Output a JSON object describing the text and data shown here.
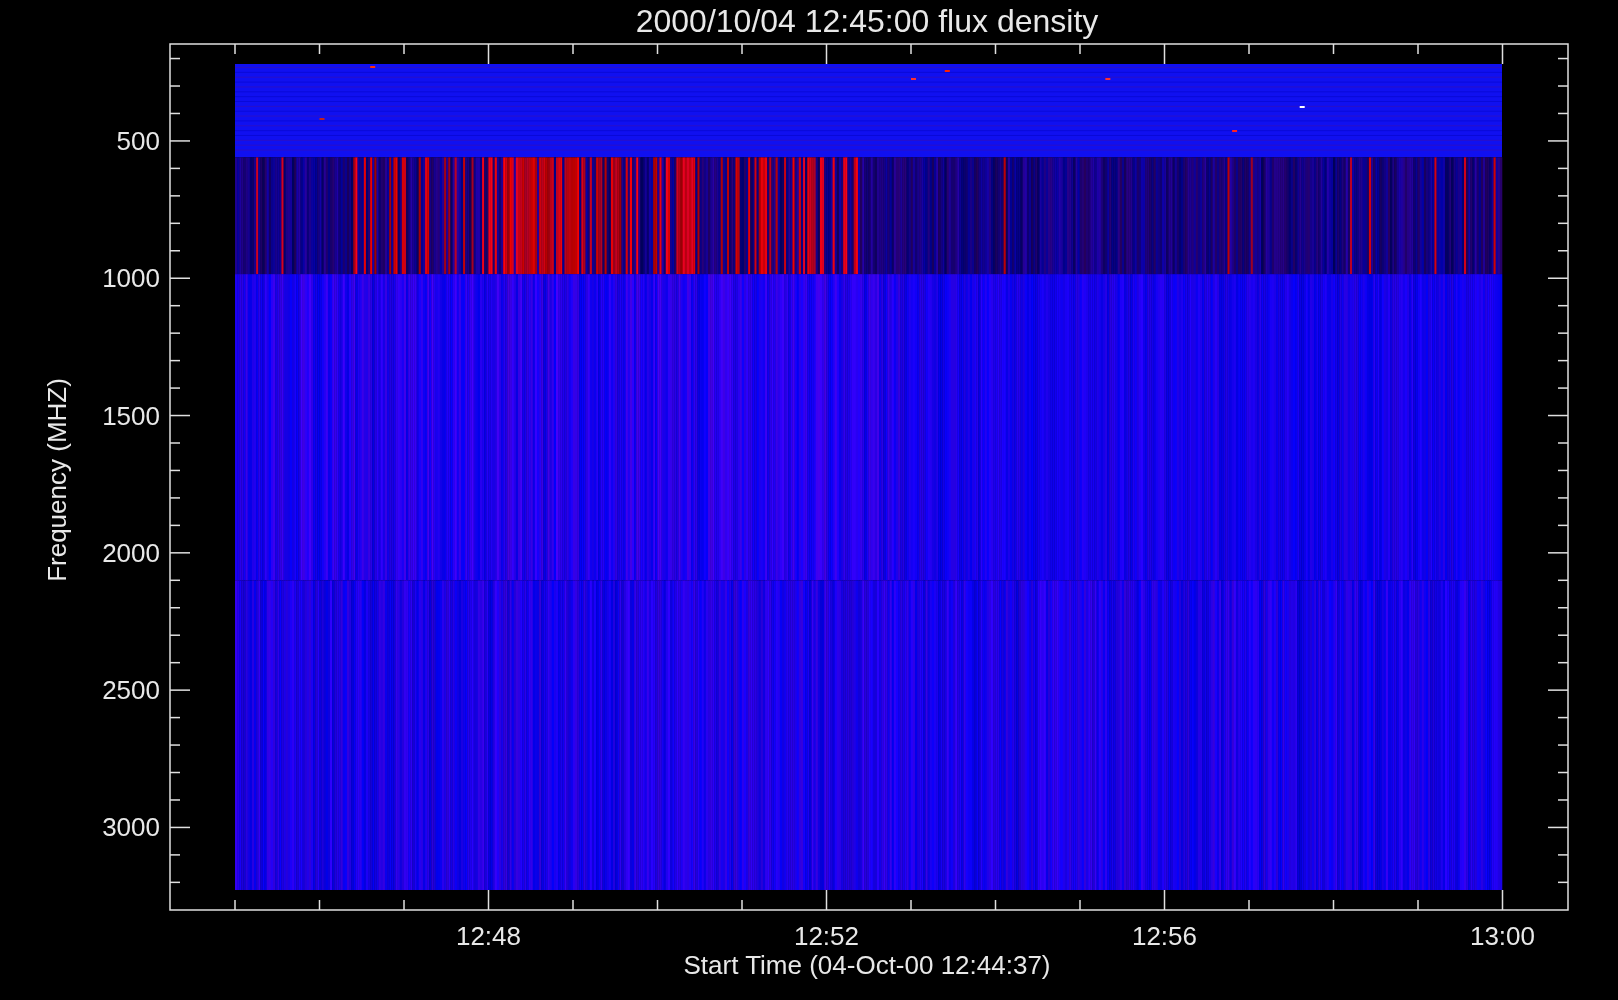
{
  "plot": {
    "title": "2000/10/04 12:45:00 flux density",
    "ylabel": "Frequency (MHZ)",
    "xlabel": "Start Time (04-Oct-00 12:44:37)",
    "yticks": [
      "500",
      "1000",
      "1500",
      "2000",
      "2500",
      "3000"
    ],
    "xticks": [
      "12:48",
      "12:52",
      "12:56",
      "13:00"
    ]
  }
}
